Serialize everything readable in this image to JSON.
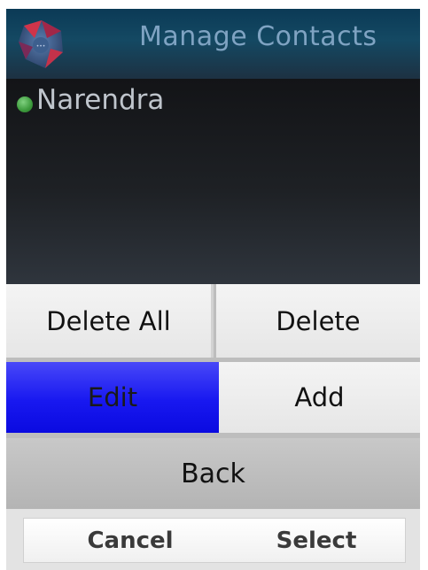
{
  "header": {
    "title": "Manage Contacts",
    "logo_icon": "app-logo-icon",
    "colors": {
      "background": "#144963",
      "title": "#7fa3c2"
    }
  },
  "contacts": [
    {
      "name": "Narendra",
      "status_icon": "online-status-icon",
      "status_color": "#3c9a3c"
    }
  ],
  "menu": {
    "delete_all_label": "Delete All",
    "delete_label": "Delete",
    "edit_label": "Edit",
    "add_label": "Add",
    "back_label": "Back",
    "selected_item": "Edit",
    "colors": {
      "selected": "#1818f0",
      "item": "#eeeeee"
    }
  },
  "softkeys": {
    "left_label": "Cancel",
    "right_label": "Select"
  }
}
